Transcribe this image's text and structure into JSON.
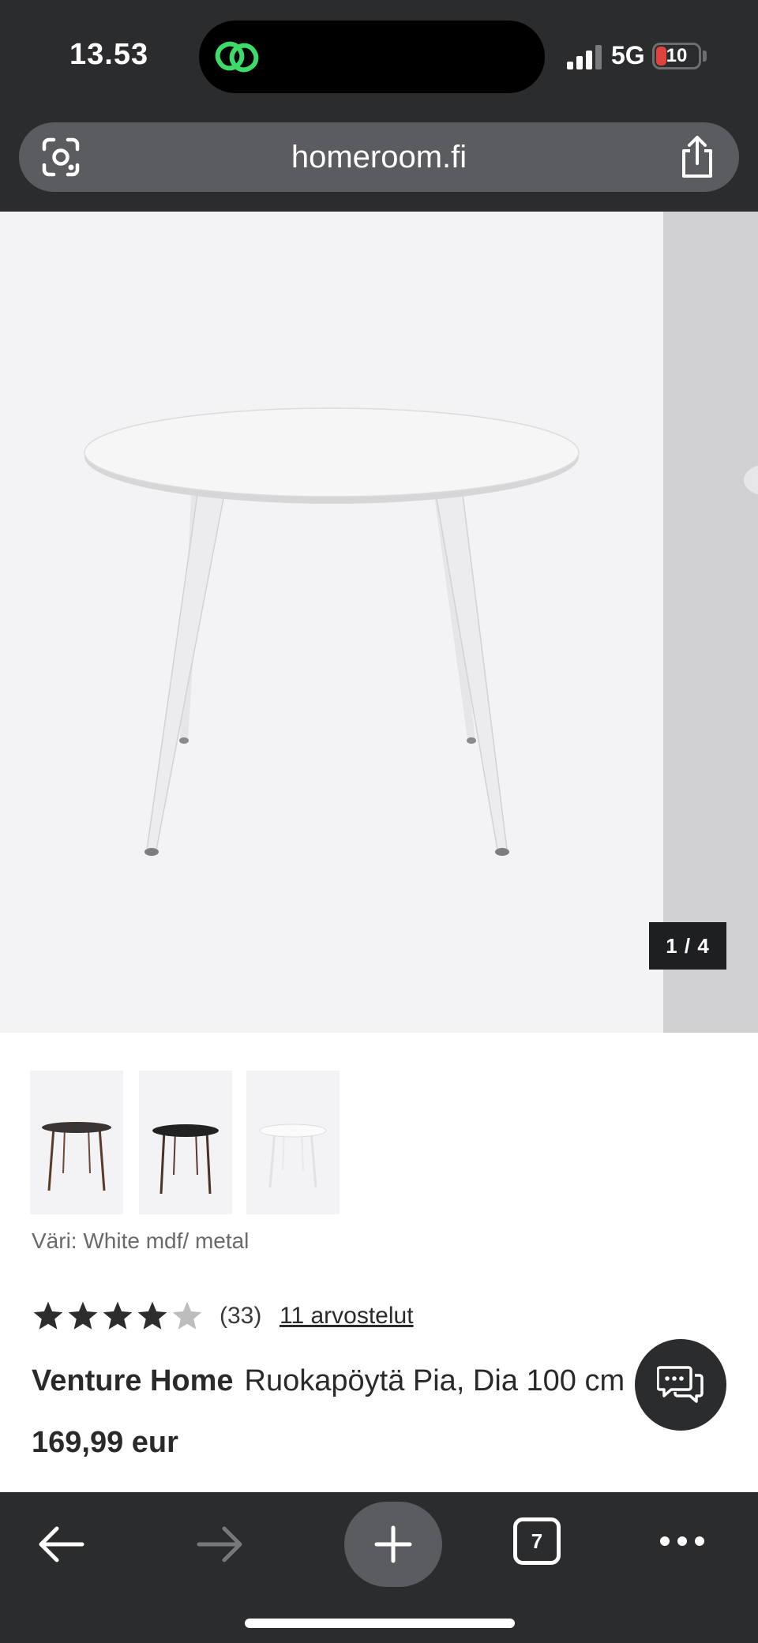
{
  "status_bar": {
    "time": "13.53",
    "network": "5G",
    "battery": "10",
    "colors": {
      "battery_low": "#e0433e",
      "island_icon": "#3ddc6a"
    }
  },
  "browser": {
    "url": "homeroom.fi",
    "open_tabs": "7",
    "icons": [
      "google-lens-icon",
      "share-icon",
      "back-arrow-icon",
      "forward-arrow-icon",
      "plus-icon",
      "more-dots-icon"
    ]
  },
  "gallery": {
    "counter": "1 / 4",
    "thumbnails": [
      {
        "icon": "dark-table-thumbnail"
      },
      {
        "icon": "black-table-thumbnail"
      },
      {
        "icon": "white-table-thumbnail"
      }
    ]
  },
  "product": {
    "color_label": "Väri: White mdf/ metal",
    "rating": 4,
    "rating_max": 5,
    "rating_count": "(33)",
    "reviews_link": "11 arvostelut",
    "brand": "Venture Home",
    "name": "Ruokapöytä Pia, Dia 100 cm",
    "price": "169,99 eur"
  }
}
